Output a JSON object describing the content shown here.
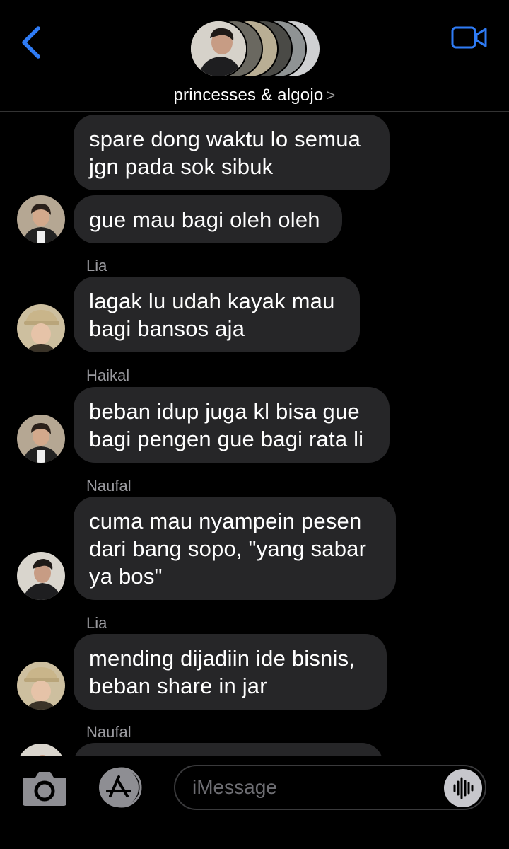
{
  "header": {
    "group_name": "princesses & algojo",
    "chevron": ">"
  },
  "colors": {
    "accent": "#2f7cf6",
    "bubble": "#262628",
    "background": "#000000",
    "sender_label": "#9a9a9f"
  },
  "icons": {
    "back": "back-chevron-icon",
    "video": "video-camera-icon",
    "camera": "camera-icon",
    "app_store": "app-store-icon",
    "audio": "audio-waveform-icon"
  },
  "messages": [
    {
      "text_lines": [
        "spare dong waktu lo semua",
        "jgn pada sok sibuk"
      ]
    },
    {
      "text_lines": [
        "gue mau bagi oleh oleh"
      ]
    },
    {
      "sender": "Lia",
      "text_lines": [
        "lagak lu udah kayak mau",
        "bagi bansos aja"
      ]
    },
    {
      "sender": "Haikal",
      "text_lines": [
        "beban idup juga kl bisa gue",
        "bagi pengen gue bagi rata li"
      ]
    },
    {
      "sender": "Naufal",
      "text_lines": [
        "cuma mau nyampein pesen",
        "dari bang sopo, \"yang sabar",
        "ya bos\""
      ]
    },
    {
      "sender": "Lia",
      "text_lines": [
        "mending dijadiin ide bisnis,",
        "beban share in jar"
      ]
    },
    {
      "sender": "Naufal",
      "text_lines": []
    }
  ],
  "composer": {
    "placeholder": "iMessage"
  }
}
